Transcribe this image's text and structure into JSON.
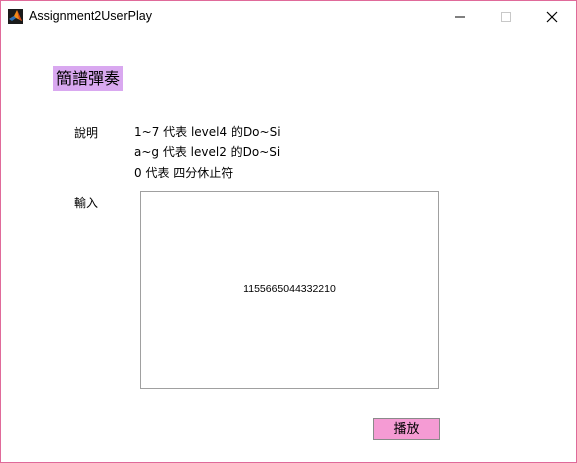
{
  "window": {
    "title": "Assignment2UserPlay",
    "icon": "matlab-icon",
    "controls": [
      "minimize-icon",
      "maximize-icon",
      "close-icon"
    ],
    "accent": "#e06a9a"
  },
  "heading": {
    "text": "簡譜彈奏",
    "background": "#d9a8f0"
  },
  "description": {
    "label": "說明",
    "lines": [
      "1~7 代表 level4 的Do~Si",
      "a~g 代表 level2 的Do~Si",
      "0 代表 四分休止符"
    ]
  },
  "input": {
    "label": "輸入",
    "value": "1155665044332210"
  },
  "play_button": {
    "label": "播放",
    "background": "#f59bd4"
  }
}
